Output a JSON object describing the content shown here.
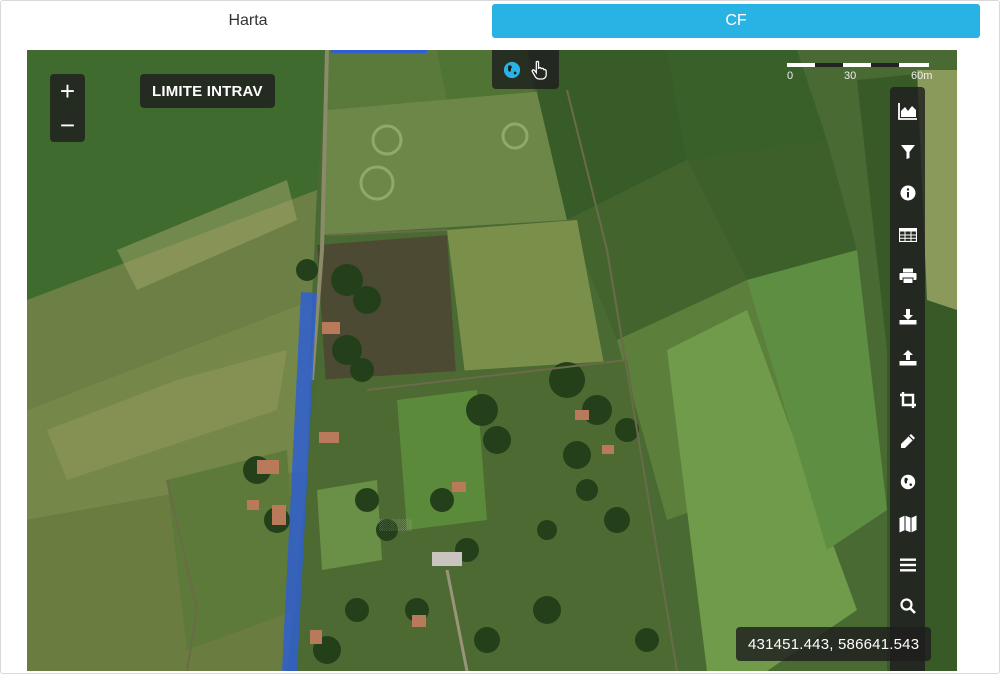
{
  "tabs": [
    {
      "label": "Harta",
      "active": false
    },
    {
      "label": "CF",
      "active": true
    }
  ],
  "map": {
    "zoom_in": "+",
    "zoom_out": "−",
    "layer_badge": "LIMITE INTRAV",
    "mode_buttons": [
      {
        "icon": "globe-icon",
        "active": true
      },
      {
        "icon": "hand-pointer-icon",
        "active": false
      }
    ],
    "scale": {
      "labels": [
        "0",
        "30",
        "60m"
      ]
    },
    "toolbar": [
      {
        "icon": "area-chart-icon"
      },
      {
        "icon": "filter-icon"
      },
      {
        "icon": "info-icon"
      },
      {
        "icon": "table-icon"
      },
      {
        "icon": "print-icon"
      },
      {
        "icon": "download-icon"
      },
      {
        "icon": "upload-icon"
      },
      {
        "icon": "crop-icon"
      },
      {
        "icon": "pencil-icon"
      },
      {
        "icon": "globe-icon"
      },
      {
        "icon": "map-icon"
      },
      {
        "icon": "menu-icon"
      },
      {
        "icon": "search-icon"
      }
    ],
    "coordinates": "431451.443, 586641.543"
  },
  "colors": {
    "accent": "#29b3e4",
    "control_bg": "#1e1e1e",
    "highlight_parcel": "#2f5fd0"
  }
}
